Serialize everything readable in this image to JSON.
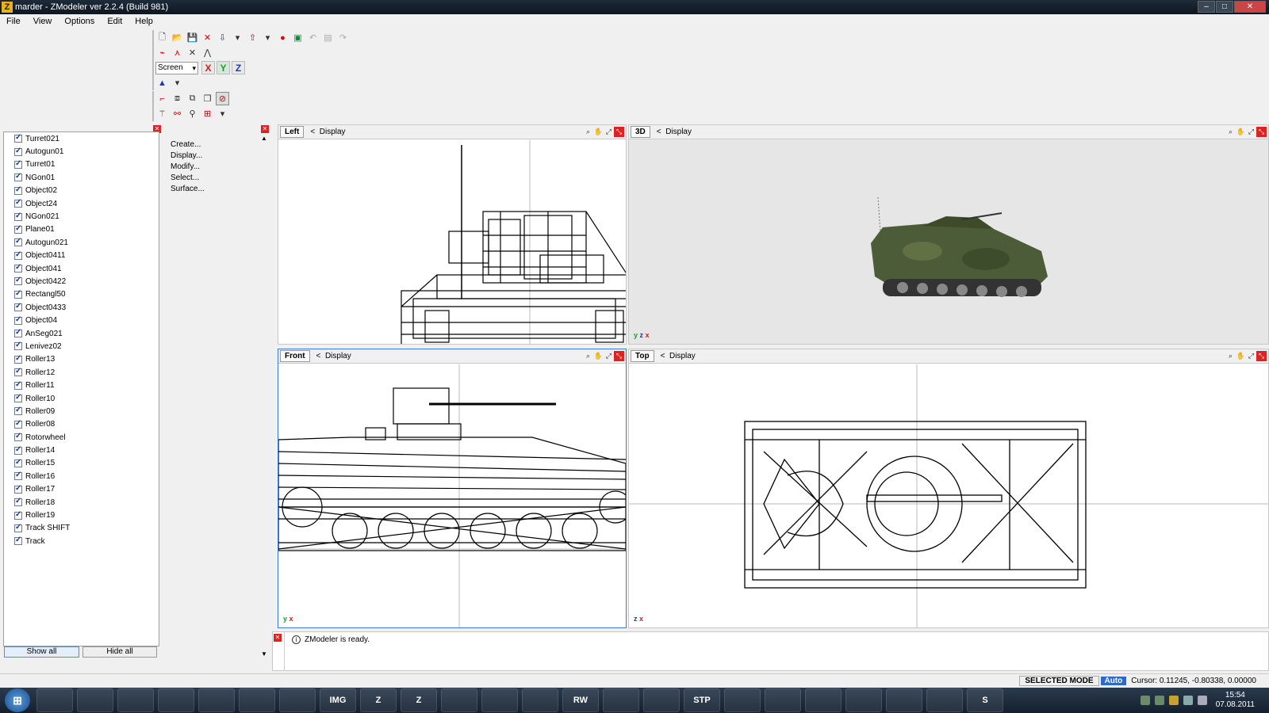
{
  "window": {
    "title": "marder - ZModeler ver 2.2.4 (Build 981)"
  },
  "menu": [
    "File",
    "View",
    "Options",
    "Edit",
    "Help"
  ],
  "toolbar": {
    "coord_mode": "Screen",
    "axes": [
      "X",
      "Y",
      "Z"
    ],
    "colors": {
      "x": "#d41c1c",
      "y": "#1a9a3a",
      "z": "#1a3bb5"
    }
  },
  "objects": [
    "Turret021",
    "Autogun01",
    "Turret01",
    "NGon01",
    "Object02",
    "Object24",
    "NGon021",
    "Plane01",
    "Autogun021",
    "Object0411",
    "Object041",
    "Object0422",
    "Rectangl50",
    "Object0433",
    "Object04",
    "AnSeg021",
    "Lenivez02",
    "Roller13",
    "Roller12",
    "Roller11",
    "Roller10",
    "Roller09",
    "Roller08",
    "Rotorwheel",
    "Roller14",
    "Roller15",
    "Roller16",
    "Roller17",
    "Roller18",
    "Roller19",
    "Track SHIFT",
    "Track"
  ],
  "left_buttons": {
    "show_all": "Show all",
    "hide_all": "Hide all"
  },
  "commands": [
    "Create...",
    "Display...",
    "Modify...",
    "Select...",
    "Surface..."
  ],
  "viewports": {
    "left": {
      "name": "Left",
      "menu": "Display"
    },
    "3d": {
      "name": "3D",
      "menu": "Display"
    },
    "front": {
      "name": "Front",
      "menu": "Display"
    },
    "top": {
      "name": "Top",
      "menu": "Display"
    }
  },
  "console": {
    "message": "ZModeler is ready."
  },
  "status": {
    "mode": "SELECTED MODE",
    "auto": "Auto",
    "cursor": "Cursor: 0.11245, -0.80338, 0.00000"
  },
  "taskbar": {
    "apps": [
      "",
      "",
      "",
      "",
      "",
      "",
      "",
      "IMG",
      "Z",
      "Z",
      "",
      "",
      "",
      "RW",
      "",
      "",
      "STP",
      "",
      "",
      "",
      "",
      "",
      "",
      "S"
    ],
    "time": "15:54",
    "date": "07.08.2011"
  }
}
